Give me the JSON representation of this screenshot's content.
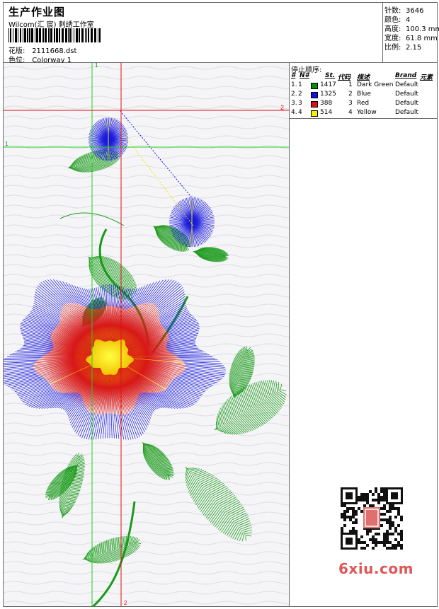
{
  "header": {
    "title": "生产作业图",
    "company": "Wilcom(汇 宸) 刺绣工作室",
    "design_label": "花版:",
    "design_file": "2111668.dst",
    "colorway_label": "色位:",
    "colorway": "Colorway 1"
  },
  "stats": [
    {
      "label": "针数:",
      "value": "3646"
    },
    {
      "label": "颜色:",
      "value": "4"
    },
    {
      "label": "高度:",
      "value": "100.3 mm"
    },
    {
      "label": "宽度:",
      "value": "61.8 mm"
    },
    {
      "label": "比例:",
      "value": "2.15"
    }
  ],
  "stop_sequence": {
    "heading": "停止顺序:",
    "columns": [
      "#",
      "N#",
      "St.",
      "代码",
      "描述",
      "Brand",
      "元素"
    ],
    "rows": [
      {
        "num": "1.",
        "n": "1",
        "st": "1417",
        "code": "1",
        "desc": "Dark Green",
        "brand": "Default",
        "color": "#0a8a0a"
      },
      {
        "num": "2.",
        "n": "2",
        "st": "1325",
        "code": "2",
        "desc": "Blue",
        "brand": "Default",
        "color": "#1010e0"
      },
      {
        "num": "3.",
        "n": "3",
        "st": "388",
        "code": "3",
        "desc": "Red",
        "brand": "Default",
        "color": "#e01010"
      },
      {
        "num": "4.",
        "n": "4",
        "st": "514",
        "code": "4",
        "desc": "Yellow",
        "brand": "Default",
        "color": "#f5f000"
      }
    ]
  },
  "guides": {
    "v1": "1",
    "h1": "1",
    "v2": "2",
    "h2": "2"
  },
  "watermark": "6xiu.com"
}
